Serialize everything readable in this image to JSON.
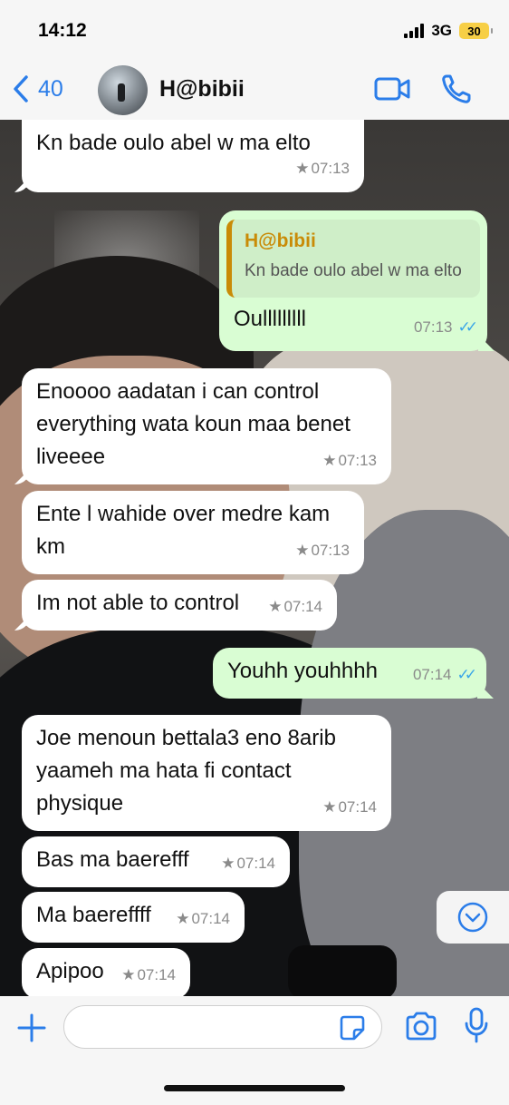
{
  "status_bar": {
    "time": "14:12",
    "network": "3G",
    "battery": "30"
  },
  "header": {
    "back_count": "40",
    "contact_name": "H@bibii",
    "icons": {
      "back": "chevron-left-icon",
      "video": "video-camera-icon",
      "call": "phone-icon"
    }
  },
  "messages": [
    {
      "direction": "in",
      "text": "Kn bade oulo abel w ma elto",
      "time": "07:13",
      "starred": true
    },
    {
      "direction": "out",
      "reply_to": {
        "name": "H@bibii",
        "text": "Kn bade oulo abel w ma elto"
      },
      "text": "Oulllllllll",
      "time": "07:13",
      "read": true
    },
    {
      "direction": "in",
      "text": "Enoooo aadatan i can control everything wata koun maa benet liveeee",
      "time": "07:13",
      "starred": true
    },
    {
      "direction": "in",
      "text": "Ente l wahide over medre kam km",
      "time": "07:13",
      "starred": true
    },
    {
      "direction": "in",
      "text": "Im not able to control",
      "time": "07:14",
      "starred": true
    },
    {
      "direction": "out",
      "text": "Youhh youhhhh",
      "time": "07:14",
      "read": true
    },
    {
      "direction": "in",
      "text": "Joe menoun bettala3 eno 8arib yaameh ma hata fi contact physique",
      "time": "07:14",
      "starred": true
    },
    {
      "direction": "in",
      "text": "Bas ma baerefff",
      "time": "07:14",
      "starred": true
    },
    {
      "direction": "in",
      "text": "Ma baereffff",
      "time": "07:14",
      "starred": true
    },
    {
      "direction": "in",
      "text": "Apipoo",
      "time": "07:14",
      "starred": true
    }
  ],
  "input_bar": {
    "message_placeholder": "",
    "message_value": ""
  },
  "colors": {
    "accent": "#2b7de9",
    "outgoing_bubble": "#d9fdd3",
    "reply_name": "#c98b07",
    "read_ticks": "#3aa6e8"
  }
}
